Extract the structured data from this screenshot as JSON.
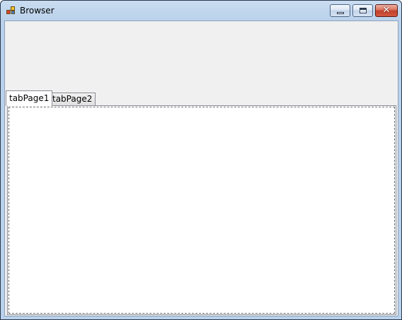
{
  "window": {
    "title": "Browser",
    "icon": "app-window-icon"
  },
  "tabs": [
    {
      "label": "tabPage1",
      "selected": true
    },
    {
      "label": "tabPage2",
      "selected": false
    }
  ]
}
